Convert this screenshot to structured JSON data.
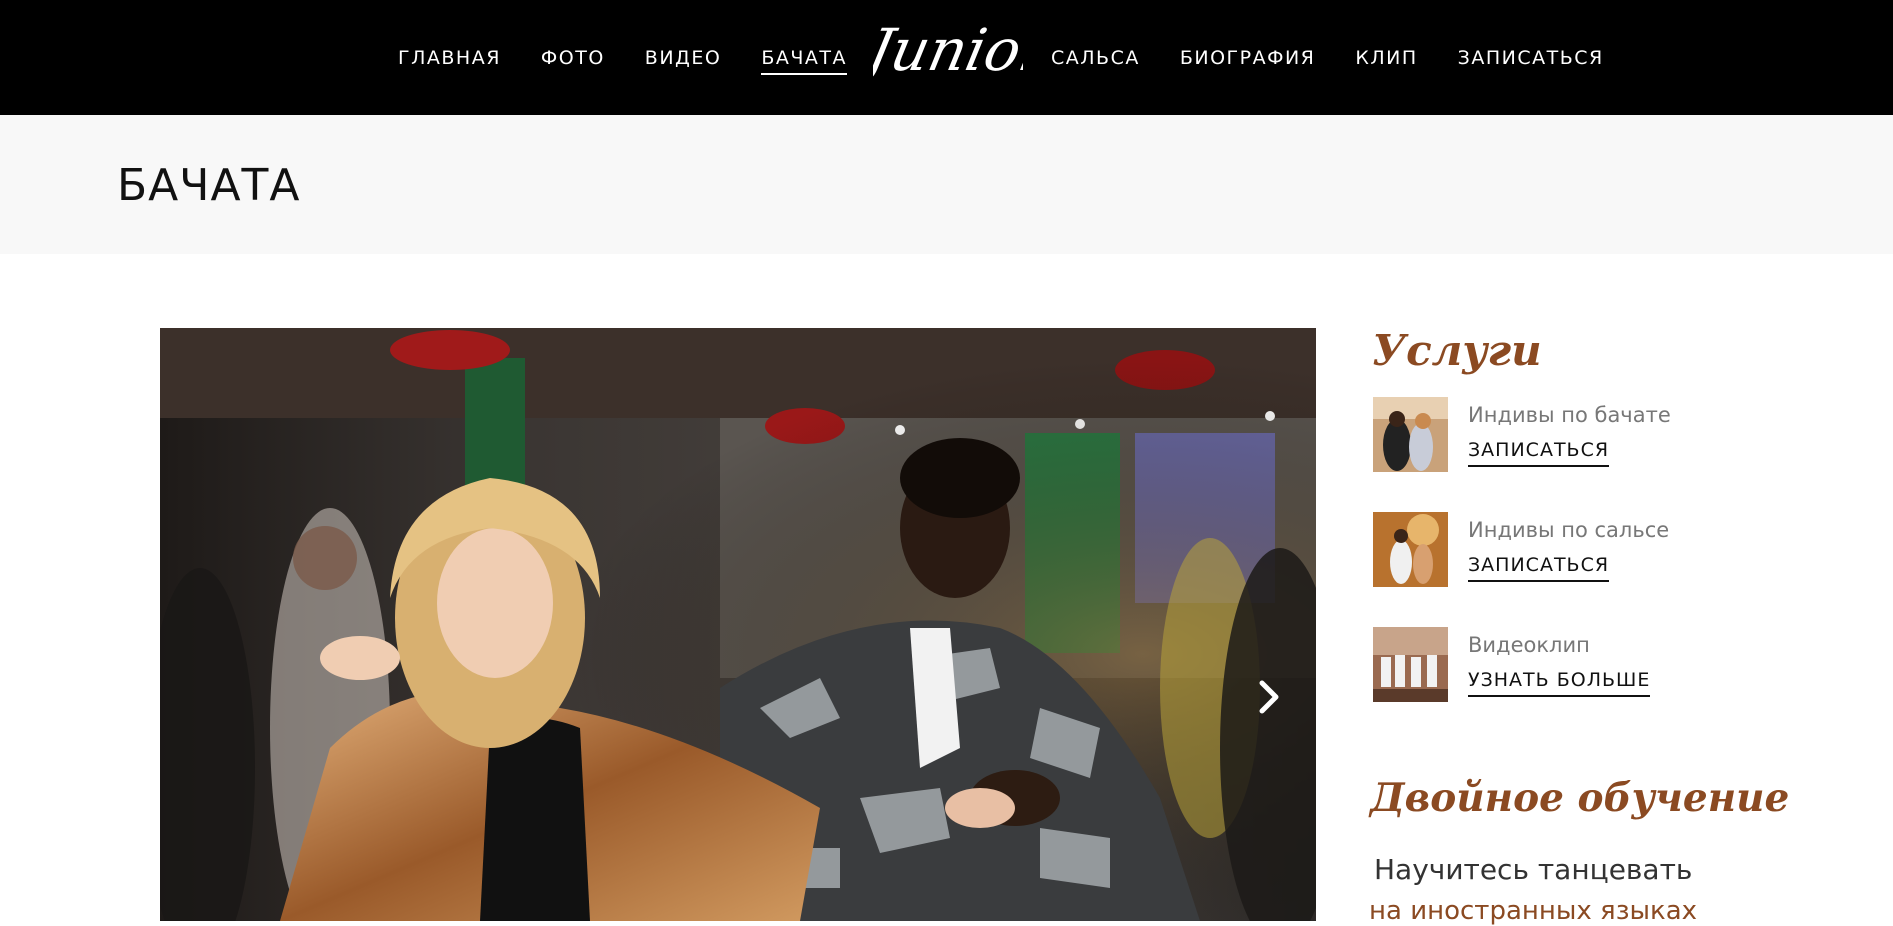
{
  "header": {
    "nav_left": [
      "ГЛАВНАЯ",
      "ФОТО",
      "ВИДЕО",
      "БАЧАТА"
    ],
    "nav_right": [
      "САЛЬСА",
      "БИОГРАФИЯ",
      "КЛИП",
      "ЗАПИСАТЬСЯ"
    ],
    "active_item": "БАЧАТА",
    "logo_text": "Junior"
  },
  "page": {
    "title": "БАЧАТА"
  },
  "hero": {
    "image": "photo of couple dancing bachata at a party",
    "next_icon": "chevron-right-icon"
  },
  "sidebar": {
    "services_heading": "Услуги",
    "services": [
      {
        "label": "Индивы по бачате",
        "link": "ЗАПИСАТЬСЯ"
      },
      {
        "label": "Индивы по сальсе",
        "link": "ЗАПИСАТЬСЯ"
      },
      {
        "label": "Видеоклип",
        "link": "УЗНАТЬ БОЛЬШЕ"
      }
    ],
    "double_heading": "Двойное обучение",
    "promo_line1": "Научитесь танцевать",
    "promo_line2": "на иностранных языках"
  },
  "colors": {
    "header_bg": "#000000",
    "title_band_bg": "#f8f8f8",
    "accent_brown": "#8b4a22"
  }
}
